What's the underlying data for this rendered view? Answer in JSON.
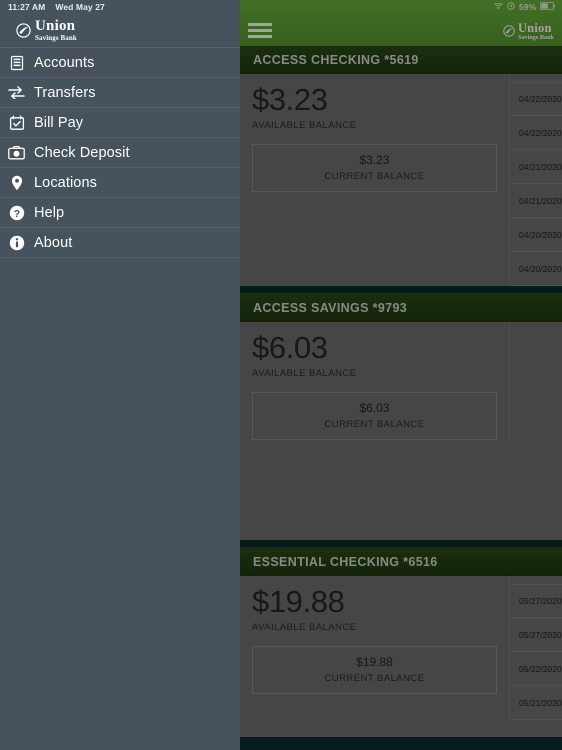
{
  "status_bar": {
    "time": "11:27 AM",
    "date": "Wed May 27",
    "wifi_icon": "wifi-icon",
    "location_icon": "location-services-icon",
    "battery_percent": "59%",
    "battery_icon": "battery-icon"
  },
  "brand": {
    "name": "Union",
    "tagline": "Savings Bank",
    "logo_icon": "union-savings-bank-logo",
    "green": "#5a9e32",
    "dark_green": "#243d13",
    "sidebar_slate": "#46525c",
    "page_background": "#0d2b2b"
  },
  "sidebar": {
    "menu_icon": "hamburger-icon",
    "items": [
      {
        "label": "Accounts",
        "icon": "accounts-icon"
      },
      {
        "label": "Transfers",
        "icon": "transfers-icon"
      },
      {
        "label": "Bill Pay",
        "icon": "bill-pay-calendar-icon"
      },
      {
        "label": "Check Deposit",
        "icon": "camera-icon"
      },
      {
        "label": "Locations",
        "icon": "map-pin-icon"
      },
      {
        "label": "Help",
        "icon": "question-mark-icon"
      },
      {
        "label": "About",
        "icon": "info-icon"
      }
    ]
  },
  "labels": {
    "available_balance": "AVAILABLE BALANCE",
    "current_balance": "CURRENT BALANCE"
  },
  "accounts": [
    {
      "title": "ACCESS CHECKING *5619",
      "available_balance": "$3.23",
      "current_balance": "$3.23",
      "transactions": [
        {
          "date": "04/22/2020"
        },
        {
          "date": "04/22/2020"
        },
        {
          "date": "04/21/2020"
        },
        {
          "date": "04/21/2020"
        },
        {
          "date": "04/20/2020"
        },
        {
          "date": "04/20/2020"
        }
      ]
    },
    {
      "title": "ACCESS SAVINGS *9793",
      "available_balance": "$6.03",
      "current_balance": "$6.03",
      "transactions": []
    },
    {
      "title": "ESSENTIAL CHECKING *6516",
      "available_balance": "$19.88",
      "current_balance": "$19.88",
      "transactions": [
        {
          "date": "05/27/2020"
        },
        {
          "date": "05/27/2020"
        },
        {
          "date": "05/22/2020"
        },
        {
          "date": "05/21/2020"
        }
      ]
    }
  ]
}
